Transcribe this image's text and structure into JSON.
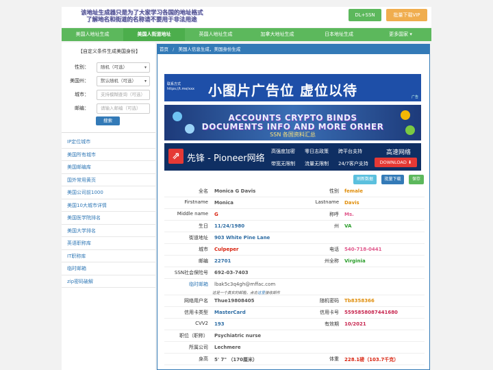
{
  "header": {
    "notice_line1": "该地址生成器只是为了大家学习各国的地址格式",
    "notice_line2": "了解地名和街道的名称请不要用于非法用途",
    "btn_dl_ssn": "DL+SSN",
    "btn_vip": "批量下载VIP"
  },
  "nav": {
    "items": [
      {
        "label": "美国人地址生成"
      },
      {
        "label": "美国人街道地址"
      },
      {
        "label": "英国人地址生成"
      },
      {
        "label": "加拿大地址生成"
      },
      {
        "label": "日本地址生成"
      },
      {
        "label": "更多国家 ▾"
      }
    ]
  },
  "sidebar": {
    "form_title": "【自定义条件生成美国身份】",
    "gender_label": "性别：",
    "gender_value": "随机（可选）",
    "state_label": "美国州：",
    "state_value": "默认随机（可选）",
    "city_label": "城市：",
    "city_placeholder": "支持模糊查询（可选）",
    "zip_label": "邮编：",
    "zip_placeholder": "请输入邮编（可选）",
    "search_button": "搜索",
    "links": [
      "IP定位城市",
      "美国所有城市",
      "美国邮编库",
      "国外常用黄页",
      "美国公司前1000",
      "美国10大城市详情",
      "美国医学院排名",
      "美国大学排名",
      "英语职称库",
      "IT职称库",
      "临时邮箱",
      "zip密码破解"
    ]
  },
  "main": {
    "breadcrumb_home": "首页",
    "breadcrumb_sep": "/",
    "breadcrumb_current": "美国人信息生成，美国身份生成",
    "banner1": {
      "contact_line1": "联系方式",
      "contact_line2": "https://t.me/xxx",
      "text": "小图片广告位 虚位以待",
      "logo": "广告"
    },
    "banner2": {
      "line1": "ACCOUNTS CRYPTO BINDS",
      "line2": "DOCUMENTS INFO AND MORE ORHER",
      "line3": "SSN 各国资料汇总"
    },
    "banner3": {
      "brand": "先锋 - Pioneer网络",
      "features": [
        "高强度加密",
        "零日志政策",
        "跨平台支持",
        "带宽无限制",
        "流量无限制",
        "24/7客户支持"
      ],
      "speed": "高速网络",
      "download": "DOWNLOAD ⬇"
    },
    "buttons": {
      "refresh": "刷新数据",
      "batch": "批量下载",
      "save": "保存"
    },
    "colors": {
      "orange": "#e08e0b",
      "red": "#d9230f",
      "green": "#2a9d2a",
      "pink": "#e0568a",
      "blue": "#2e6da4",
      "dark_red": "#c7254e"
    },
    "info": {
      "full_name_label": "全名",
      "full_name": "Monica G Davis",
      "gender_label": "性别",
      "gender": "female",
      "firstname_label": "Firstname",
      "firstname": "Monica",
      "lastname_label": "Lastname",
      "lastname": "Davis",
      "middle_label": "Middle name",
      "middle": "G",
      "title_label": "称呼",
      "title": "Ms.",
      "dob_label": "生日",
      "dob": "11/24/1980",
      "state_label": "州",
      "state": "VA",
      "street_label": "街道地址",
      "street": "903 White Pine Lane",
      "city_label": "城市",
      "city": "Culpeper",
      "phone_label": "电话",
      "phone": "540-718-0441",
      "zip_label": "邮编",
      "zip": "22701",
      "state_full_label": "州全称",
      "state_full": "Virginia",
      "ssn_label": "SSN社会保险号",
      "ssn": "692-03-7403",
      "email_label": "临时邮箱",
      "email": "lbak5c3q4gh@mffac.com",
      "email_note_pre": "这是一个真实的邮箱，点击",
      "email_note_link": "这里",
      "email_note_post": "接收邮件",
      "username_label": "网络用户名",
      "username": "Thue19808405",
      "password_label": "随机密码",
      "password": "Tb8358366",
      "card_type_label": "信用卡类型",
      "card_type": "MasterCard",
      "card_no_label": "信用卡号",
      "card_no": "5595858087441680",
      "cvv_label": "CVV2",
      "cvv": "193",
      "expiry_label": "有效期",
      "expiry": "10/2021",
      "job_label": "职位（职称）",
      "job": "Psychiatric nurse",
      "company_label": "所属公司",
      "company": "Lechmere",
      "height_label": "身高",
      "height": "5' 7\" （170厘米）",
      "weight_label": "体重",
      "weight": "228.1磅（103.7千克）"
    }
  }
}
